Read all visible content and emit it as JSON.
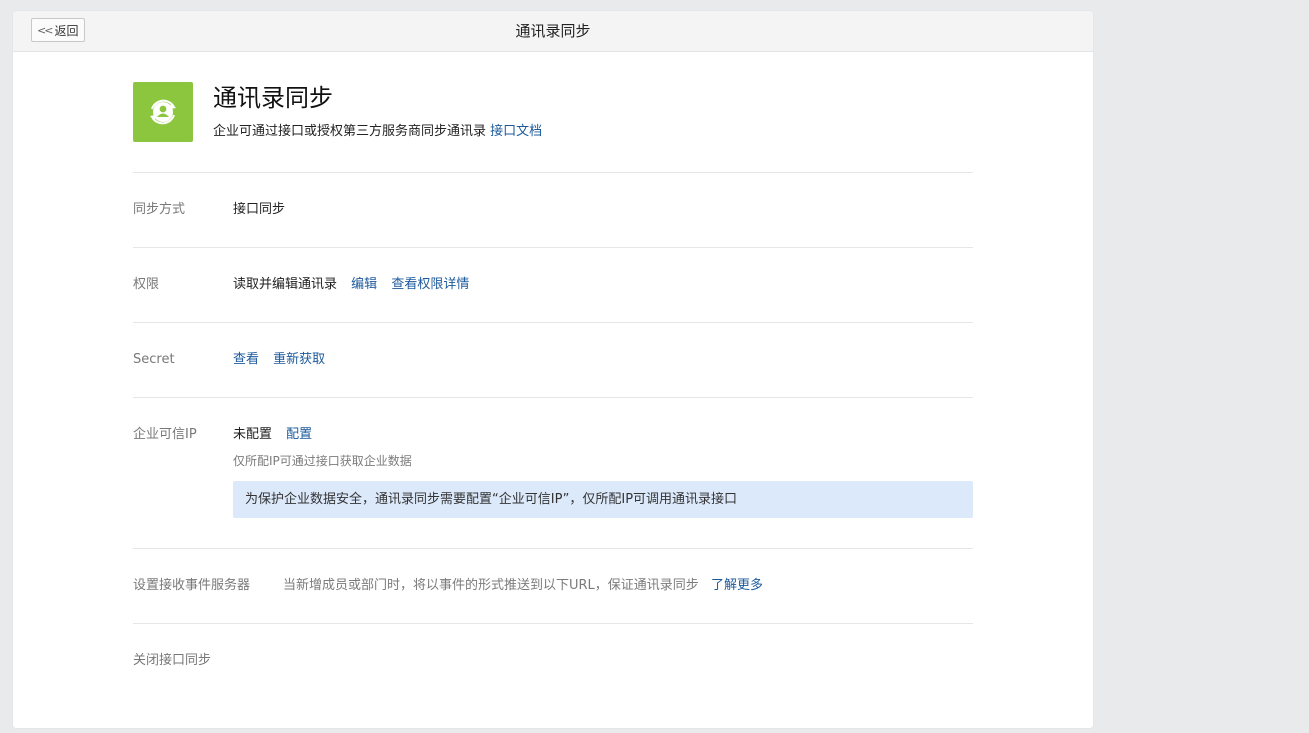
{
  "topbar": {
    "back_label": "返回",
    "title": "通讯录同步"
  },
  "app": {
    "icon": "contact-sync-icon",
    "icon_color": "#8cc63f",
    "title": "通讯录同步",
    "description": "企业可通过接口或授权第三方服务商同步通讯录",
    "doc_link": "接口文档"
  },
  "sync_mode": {
    "label": "同步方式",
    "value": "接口同步"
  },
  "permission": {
    "label": "权限",
    "value": "读取并编辑通讯录",
    "edit_link": "编辑",
    "details_link": "查看权限详情"
  },
  "secret": {
    "label": "Secret",
    "view_link": "查看",
    "refresh_link": "重新获取"
  },
  "trusted_ip": {
    "label": "企业可信IP",
    "status": "未配置",
    "config_link": "配置",
    "hint": "仅所配IP可通过接口获取企业数据",
    "notice": "为保护企业数据安全，通讯录同步需要配置“企业可信IP”，仅所配IP可调用通讯录接口",
    "notice_bg": "#dce9fb"
  },
  "event_server": {
    "label": "设置接收事件服务器",
    "description": "当新增成员或部门时，将以事件的形式推送到以下URL，保证通讯录同步",
    "more_link": "了解更多"
  },
  "close_sync": {
    "label": "关闭接口同步"
  },
  "colors": {
    "link": "#1d5a9b",
    "page_bg": "#e9eaec"
  }
}
